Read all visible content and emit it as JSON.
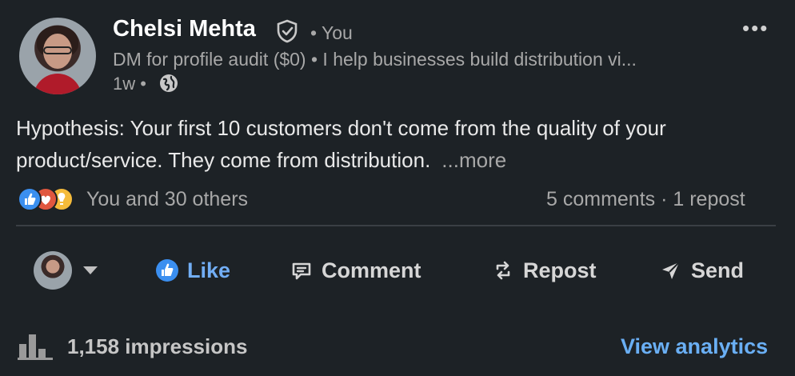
{
  "post": {
    "author": "Chelsi Mehta",
    "you_label": "• You",
    "headline": "DM for profile audit ($0) • I help businesses build distribution vi...",
    "time": "1w •",
    "text": "Hypothesis: Your first 10 customers don't come from the quality of your product/service. They come from distribution.",
    "more": "...more"
  },
  "social": {
    "reactions_text": "You and 30 others",
    "comments_reposts": "5 comments · 1 repost",
    "reaction_icons": [
      "like-icon",
      "love-icon",
      "insightful-icon"
    ]
  },
  "actions": {
    "like": "Like",
    "comment": "Comment",
    "repost": "Repost",
    "send": "Send"
  },
  "footer": {
    "impressions": "1,158 impressions",
    "analytics": "View analytics"
  },
  "colors": {
    "background": "#1d2226",
    "link_blue": "#6aaff4",
    "like_blue": "#72aef5",
    "muted": "#a8a8a8"
  }
}
